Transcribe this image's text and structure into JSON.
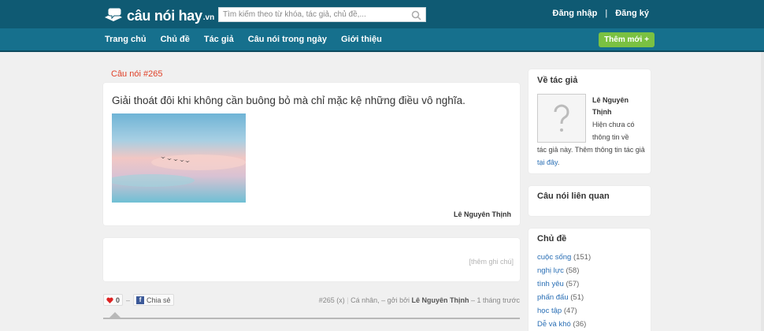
{
  "header": {
    "logo_text": "câu nói hay",
    "logo_suffix": ".vn",
    "search_placeholder": "Tìm kiếm theo từ khóa, tác giả, chủ đề,...",
    "login": "Đăng nhập",
    "separator": "|",
    "register": "Đăng ký"
  },
  "nav": {
    "items": [
      "Trang chủ",
      "Chủ đề",
      "Tác giả",
      "Câu nói trong ngày",
      "Giới thiệu"
    ],
    "add_button": "Thêm mới +"
  },
  "quote": {
    "label": "Câu nói #265",
    "text": "Giải thoát đôi khi không cần buông bỏ mà chỉ mặc kệ những điều vô nghĩa.",
    "author": "Lê Nguyên Thịnh"
  },
  "note": {
    "add_note": "[thêm ghi chú]"
  },
  "actions": {
    "like_count": "0",
    "dash": "–",
    "share_label": "Chia sẻ",
    "meta_id": "#265",
    "meta_x": "(x)",
    "meta_type": "Cá nhân, – gởi bởi",
    "meta_author": "Lê Nguyên Thịnh",
    "meta_time": "– 1 tháng trước"
  },
  "sidebar": {
    "about_title": "Về tác giả",
    "author_name": "Lê Nguyên Thịnh",
    "author_info_line1": "Hiện chưa có",
    "author_info_line2": "thông tin về",
    "author_info_rest": "tác giả này. Thêm thông tin tác giả",
    "author_info_link": "tại đây",
    "author_info_end": ".",
    "related_title": "Câu nói liên quan",
    "topics_title": "Chủ đề",
    "topics": [
      {
        "name": "cuộc sống",
        "count": "(151)"
      },
      {
        "name": "nghị lực",
        "count": "(58)"
      },
      {
        "name": "tình yêu",
        "count": "(57)"
      },
      {
        "name": "phấn đấu",
        "count": "(51)"
      },
      {
        "name": "học tập",
        "count": "(47)"
      },
      {
        "name": "Dễ và khó",
        "count": "(36)"
      }
    ]
  },
  "colors": {
    "topbar": "#0f5a73",
    "navbar": "#16708d",
    "accent_green": "#7ac142",
    "quote_label": "#e0422a",
    "link": "#2a6fb5"
  }
}
